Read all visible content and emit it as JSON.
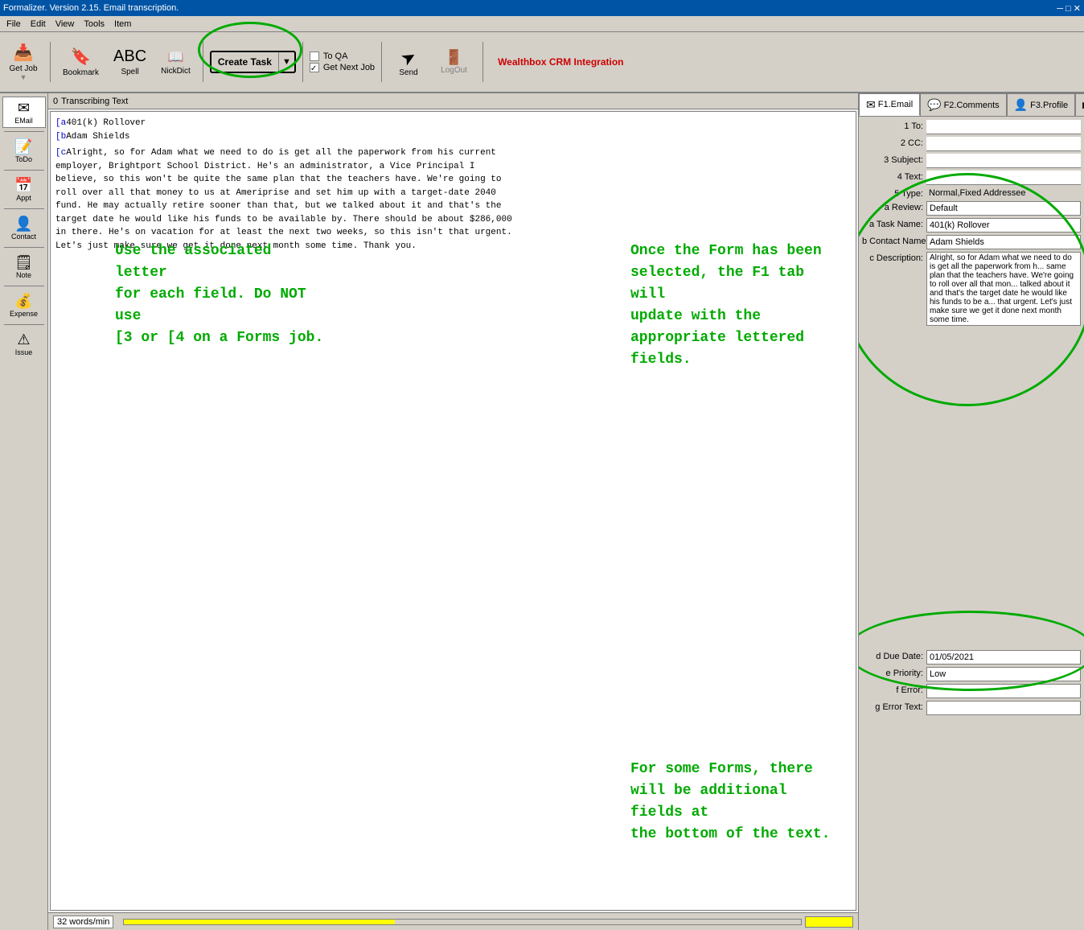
{
  "app": {
    "title": "Formalizer. Version 2.15. Email transcription.",
    "title_icon": "📋"
  },
  "menu": {
    "items": [
      "File",
      "Edit",
      "View",
      "Tools",
      "Item"
    ]
  },
  "toolbar": {
    "get_job_label": "Get Job",
    "bookmark_label": "Bookmark",
    "spell_label": "Spell",
    "nick_dict_label": "NickDict",
    "create_task_label": "Create Task",
    "to_qa_label": "To QA",
    "get_next_job_label": "Get Next Job",
    "send_label": "Send",
    "logout_label": "LogOut",
    "crm_label": "Wealthbox CRM Integration"
  },
  "sidebar": {
    "items": [
      {
        "id": "email",
        "label": "EMail",
        "icon": "✉"
      },
      {
        "id": "todo",
        "label": "ToDo",
        "icon": "📝"
      },
      {
        "id": "appt",
        "label": "Appt",
        "icon": "📅"
      },
      {
        "id": "contact",
        "label": "Contact",
        "icon": "👤"
      },
      {
        "id": "note",
        "label": "Note",
        "icon": "🗒"
      },
      {
        "id": "expense",
        "label": "Expense",
        "icon": "💰"
      },
      {
        "id": "issue",
        "label": "Issue",
        "icon": "⚠"
      }
    ]
  },
  "text_panel": {
    "header": "Transcribing Text",
    "content_lines": [
      "[a401(k) Rollover",
      "[bAdam Shields",
      "[cAlright, so for Adam what we need to do is get all the paperwork from his current",
      "employer, Brightport School District.  He's an administrator, a Vice Principal I",
      "believe, so this won't be quite the same plan that the teachers have.  We're going to",
      "roll over all that money to us at Ameriprise and set him up with a target-date 2040",
      "fund.  He may actually retire sooner than that, but we talked about it and that's the",
      "target date he would like his funds to be available by.  There should be about $286,000",
      "in there.  He's on vacation for at least the next two weeks, so this isn't that urgent.",
      "Let's just make sure we get it done next month some time.  Thank you."
    ],
    "overlay1": "Use the associated letter\nfor each field. Do NOT use\n[3 or [4 on a Forms job.",
    "overlay2": "Once the Form has been\nselected, the F1 tab will\nupdate with the\nappropriate lettered fields.",
    "overlay3": "For some Forms, there\nwill be additional fields at\nthe bottom of the text.",
    "status": "32 words/min"
  },
  "right_panel": {
    "tabs": [
      {
        "id": "f1email",
        "label": "F1.Email",
        "icon": "✉",
        "active": true
      },
      {
        "id": "f2comments",
        "label": "F2.Comments",
        "icon": "💬"
      },
      {
        "id": "f3profile",
        "label": "F3.Profile",
        "icon": "👤"
      }
    ],
    "fields": [
      {
        "label": "1 To:",
        "value": "",
        "id": "to"
      },
      {
        "label": "2 CC:",
        "value": "",
        "id": "cc"
      },
      {
        "label": "3 Subject:",
        "value": "",
        "id": "subject"
      },
      {
        "label": "4 Text:",
        "value": "",
        "id": "text"
      },
      {
        "label": "5 Type:",
        "value": "Normal,Fixed Addressee",
        "id": "type"
      },
      {
        "label": "a Review:",
        "value": "Default",
        "id": "review"
      },
      {
        "label": "a Task Name:",
        "value": "401(k) Rollover",
        "id": "task_name"
      },
      {
        "label": "b Contact Name:",
        "value": "Adam Shields",
        "id": "contact_name"
      },
      {
        "label": "c Description:",
        "value": "Alright, so for Adam what we need to do is get all the paperwork from h... same plan that the teachers have. We're going to roll over all that mon... talked about it and that's the target date he would like his funds to be a... that urgent.  Let's just make sure we get it done next month some time.",
        "id": "description",
        "multiline": true
      },
      {
        "label": "d Due Date:",
        "value": "01/05/2021",
        "id": "due_date"
      },
      {
        "label": "e Priority:",
        "value": "Low",
        "id": "priority"
      },
      {
        "label": "f Error:",
        "value": "",
        "id": "error"
      },
      {
        "label": "g Error Text:",
        "value": "",
        "id": "error_text"
      }
    ]
  }
}
